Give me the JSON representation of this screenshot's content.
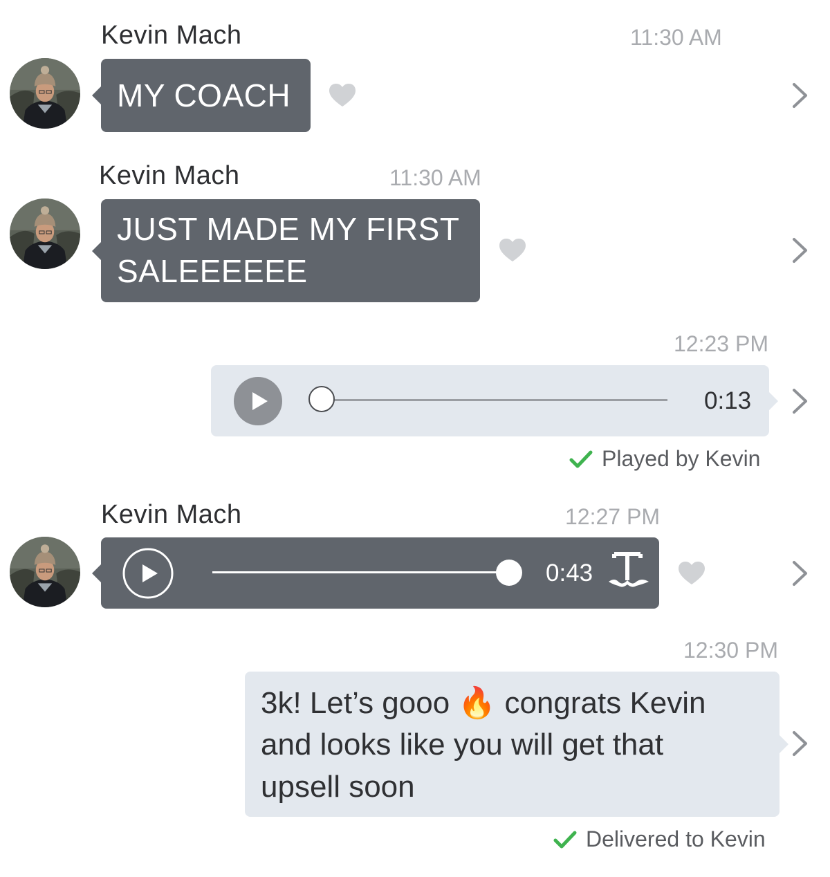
{
  "messages": [
    {
      "sender": "Kevin Mach",
      "time": "11:30 AM",
      "text": "MY COACH"
    },
    {
      "sender": "Kevin Mach",
      "time": "11:30 AM",
      "lines": [
        "JUST MADE MY FIRST",
        "SALEEEEEE"
      ]
    },
    {
      "time": "12:23 PM",
      "audio_duration": "0:13",
      "audio_progress": 0,
      "status": "Played by Kevin"
    },
    {
      "sender": "Kevin Mach",
      "time": "12:27 PM",
      "audio_duration": "0:43",
      "audio_progress": 1
    },
    {
      "time": "12:30 PM",
      "text_before_emoji": "3k! Let’s gooo",
      "emoji": "🔥",
      "text_after_emoji": "congrats Kevin",
      "lines": [
        "and looks like you will get that",
        "upsell soon"
      ],
      "status": "Delivered to Kevin"
    }
  ],
  "colors": {
    "incoming_bubble": "#60656c",
    "outgoing_bubble": "#e3e8ee",
    "check": "#3fb34f",
    "icon_gray": "#d0d2d5"
  },
  "icons": {
    "heart": "heart-icon",
    "chevron": "chevron-right-icon",
    "play": "play-icon",
    "check": "checkmark-icon",
    "transcribe": "transcribe-icon",
    "fire": "fire-emoji"
  }
}
